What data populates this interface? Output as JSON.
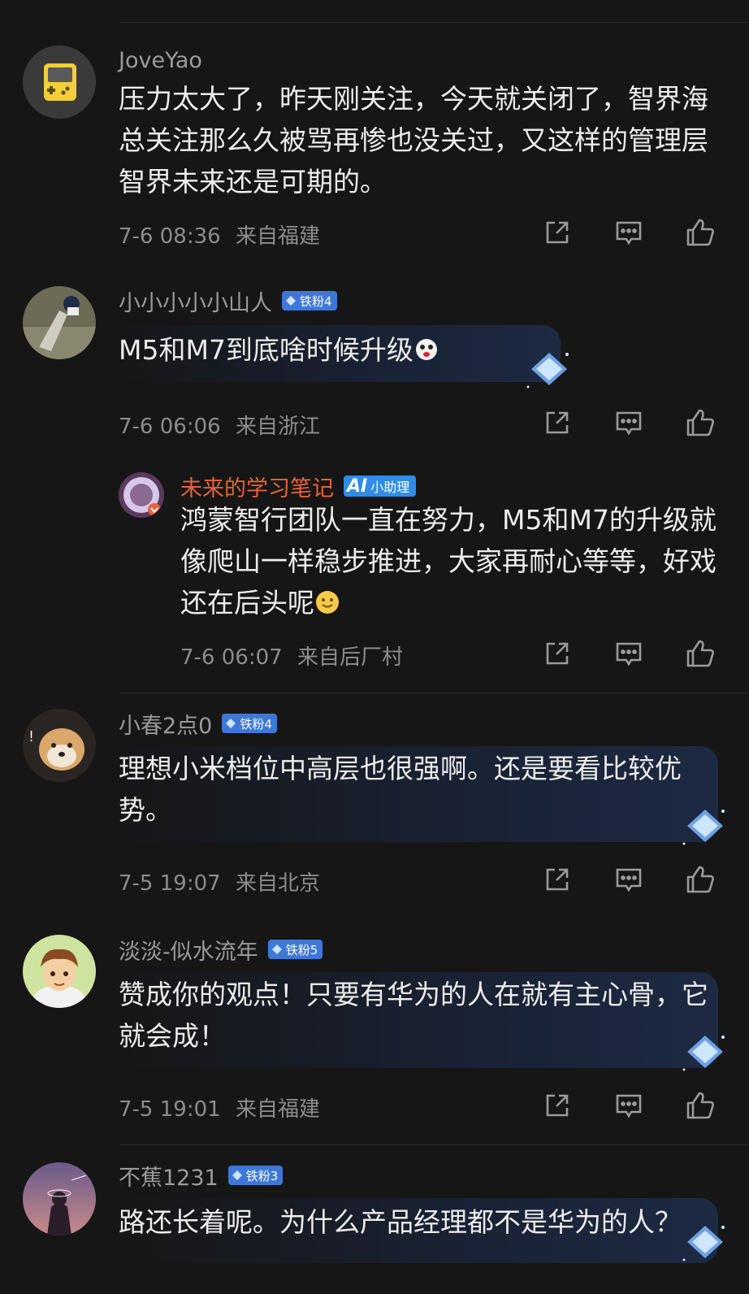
{
  "comments": [
    {
      "username": "JoveYao",
      "text": "压力太大了，昨天刚关注，今天就关闭了，智界海总关注那么久被骂再惨也没关过，又这样的管理层智界未来还是可期的。",
      "time": "7-6 08:36",
      "location": "来自福建"
    },
    {
      "username": "小小小小小山人",
      "badge": "铁粉4",
      "text": "M5和M7到底啥时候升级",
      "time": "7-6 06:06",
      "location": "来自浙江",
      "reply": {
        "username": "未来的学习笔记",
        "badge": "小助理",
        "badge_logo": "AI",
        "text": "鸿蒙智行团队一直在努力，M5和M7的升级就像爬山一样稳步推进，大家再耐心等等，好戏还在后头呢",
        "time": "7-6 06:07",
        "location": "来自后厂村"
      }
    },
    {
      "username": "小春2点0",
      "badge": "铁粉4",
      "text": "理想小米档位中高层也很强啊。还是要看比较优势。",
      "time": "7-5 19:07",
      "location": "来自北京"
    },
    {
      "username": "淡淡-似水流年",
      "badge": "铁粉5",
      "text": "赞成你的观点！只要有华为的人在就有主心骨，它就会成！",
      "time": "7-5 19:01",
      "location": "来自福建"
    },
    {
      "username": "不蕉1231",
      "badge": "铁粉3",
      "text": "路还长着呢。为什么产品经理都不是华为的人？"
    }
  ],
  "icons": {
    "share": "share-icon",
    "comment": "comment-icon",
    "like": "thumbs-up-icon",
    "badge": "diamond-icon"
  },
  "colors": {
    "background": "#161616",
    "fan_badge": "#3d78d8",
    "ai_badge": "#2f8ce8",
    "reply_name": "#e8623a"
  }
}
